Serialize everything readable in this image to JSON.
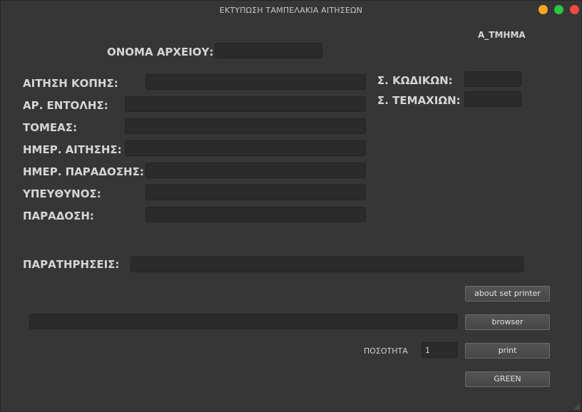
{
  "window": {
    "title": "ΕΚΤΥΠΩΣΗ ΤΑΜΠΕΛΑΚΙΑ ΑΙΤΗΣΕΩΝ",
    "department": "Α_ΤΜΗΜΑ"
  },
  "form": {
    "filename_label": "ΟΝΟΜΑ ΑΡΧΕΙΟΥ:",
    "filename_value": "",
    "cut_request_label": "ΑΙΤΗΣΗ ΚΟΠΗΣ:",
    "cut_request_value": "",
    "order_no_label": "ΑΡ. ΕΝΤΟΛΗΣ:",
    "order_no_value": "",
    "sector_label": "ΤΟΜΕΑΣ:",
    "sector_value": "",
    "request_date_label": "ΗΜΕΡ. ΑΙΤΗΣΗΣ:",
    "request_date_value": "",
    "delivery_date_label": "ΗΜΕΡ. ΠΑΡΑΔΟΣΗΣ:",
    "delivery_date_value": "",
    "responsible_label": "ΥΠΕΥΘΥΝΟΣ:",
    "responsible_value": "",
    "delivery_label": "ΠΑΡΑΔΟΣΗ:",
    "delivery_value": "",
    "total_codes_label": "Σ. ΚΩΔΙΚΩΝ:",
    "total_codes_value": "",
    "total_pieces_label": "Σ. ΤΕΜΑΧΙΩΝ:",
    "total_pieces_value": "",
    "notes_label": "ΠΑΡΑΤΗΡΗΣΕΙΣ:",
    "notes_value": ""
  },
  "controls": {
    "about_label": "about   set printer",
    "path_value": "",
    "browser_label": "browser",
    "quantity_label": "ΠΟΣΟΤΗΤΑ",
    "quantity_value": "1",
    "print_label": "print",
    "green_label": "GREEN"
  },
  "colors": {
    "background": "#363636",
    "field": "#2b2b2b",
    "text": "#d6d6d6",
    "close": "#ee4b43",
    "minimize": "#f5a623",
    "maximize": "#28c840"
  }
}
